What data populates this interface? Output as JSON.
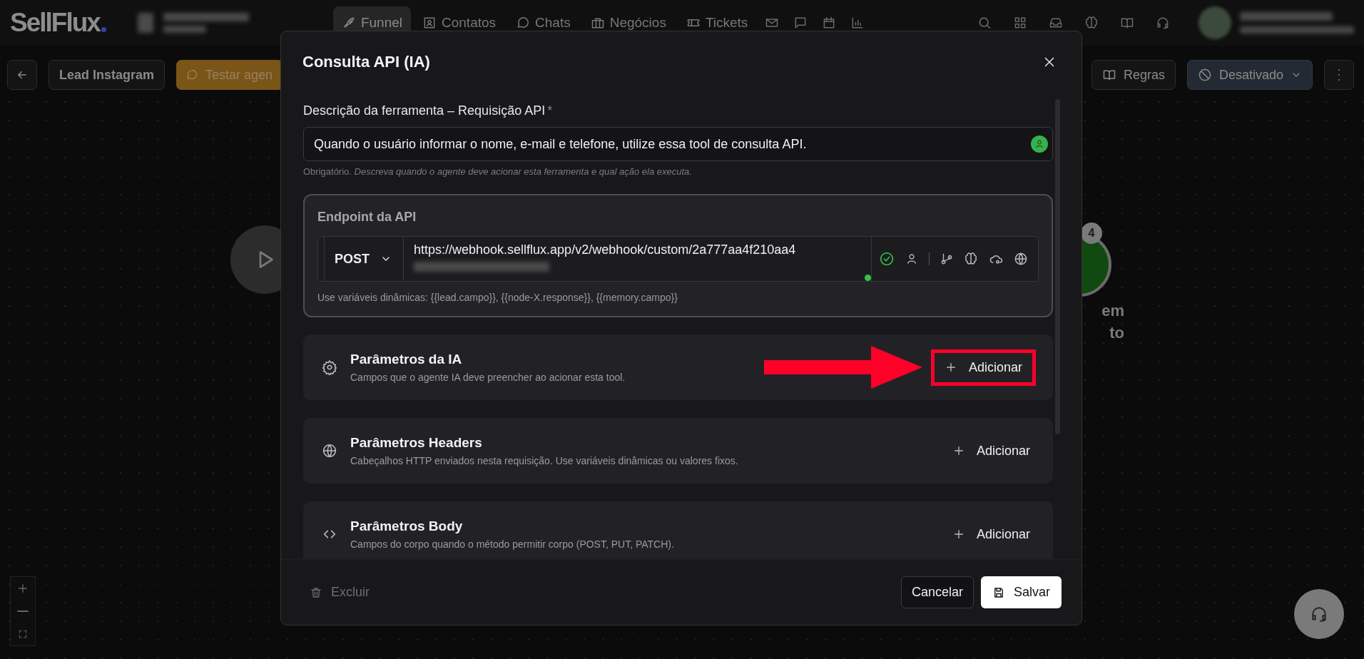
{
  "topbar": {
    "logo": "SellFlux",
    "nav": [
      {
        "label": "Funnel",
        "selected": true
      },
      {
        "label": "Contatos",
        "selected": false
      },
      {
        "label": "Chats",
        "selected": false
      },
      {
        "label": "Negócios",
        "selected": false
      },
      {
        "label": "Tickets",
        "selected": false
      }
    ]
  },
  "toolbar": {
    "flow_name": "Lead Instagram",
    "test_button": "Testar agen",
    "rules_button": "Regras",
    "status": "Desativado"
  },
  "canvas": {
    "node_badge": "4",
    "node_label_lines": [
      "em",
      "to"
    ]
  },
  "modal": {
    "title": "Consulta API (IA)",
    "description_field": {
      "label": "Descrição da ferramenta – Requisição API",
      "required_mark": "*",
      "value": "Quando o usuário informar o nome, e-mail e telefone, utilize essa tool de consulta API.",
      "hint": "Obrigatório. *Descreva quando o agente deve acionar esta ferramenta e qual ação ela executa.*"
    },
    "endpoint": {
      "title": "Endpoint da API",
      "method": "POST",
      "url": "https://webhook.sellflux.app/v2/webhook/custom/2a777aa4f210aa4",
      "valid": true,
      "hint": "Use variáveis dinâmicas: {{lead.campo}}, {{node-X.response}}, {{memory.campo}}"
    },
    "sections": [
      {
        "kind": "ai",
        "title": "Parâmetros da IA",
        "subtitle": "Campos que o agente IA deve preencher ao acionar esta tool.",
        "button": "Adicionar",
        "highlighted": true
      },
      {
        "kind": "headers",
        "title": "Parâmetros Headers",
        "subtitle": "Cabeçalhos HTTP enviados nesta requisição. Use variáveis dinâmicas ou valores fixos.",
        "button": "Adicionar",
        "highlighted": false
      },
      {
        "kind": "body",
        "title": "Parâmetros Body",
        "subtitle": "Campos do corpo quando o método permitir corpo (POST, PUT, PATCH).",
        "button": "Adicionar",
        "highlighted": false
      }
    ],
    "footer": {
      "delete": "Excluir",
      "cancel": "Cancelar",
      "save": "Salvar"
    }
  }
}
